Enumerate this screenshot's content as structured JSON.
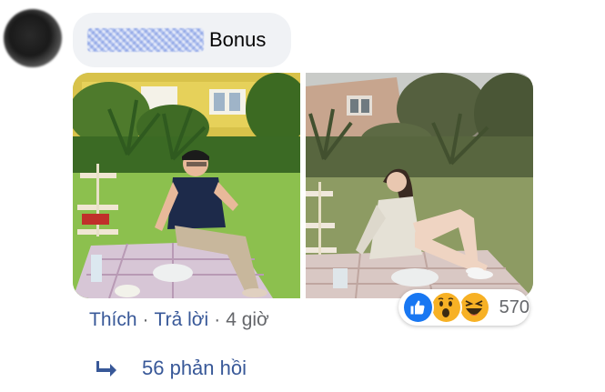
{
  "comment": {
    "text": "Bonus"
  },
  "actions": {
    "like_label": "Thích",
    "reply_label": "Trả lời",
    "separator": "·",
    "timestamp": "4 giờ"
  },
  "reactions": {
    "types": [
      "like-icon",
      "wow-icon",
      "haha-icon"
    ],
    "count": "570"
  },
  "replies": {
    "label": "56 phản hồi"
  },
  "colors": {
    "link": "#385898",
    "bubble": "#f0f2f5",
    "like": "#1877f2",
    "emoji": "#f7b125"
  }
}
